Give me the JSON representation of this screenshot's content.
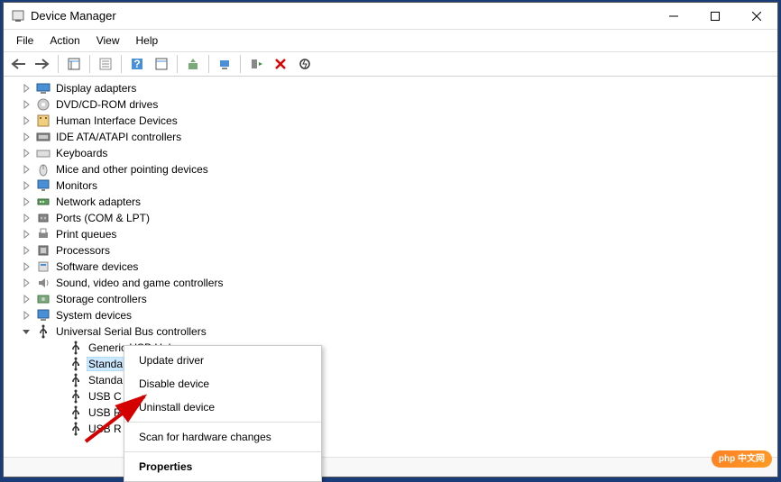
{
  "window": {
    "title": "Device Manager"
  },
  "menu": {
    "file": "File",
    "action": "Action",
    "view": "View",
    "help": "Help"
  },
  "tree": {
    "categories": [
      {
        "name": "Display adapters",
        "icon": "displayadapter",
        "expanded": false,
        "children": []
      },
      {
        "name": "DVD/CD-ROM drives",
        "icon": "dvd",
        "expanded": false,
        "children": []
      },
      {
        "name": "Human Interface Devices",
        "icon": "hid",
        "expanded": false,
        "children": []
      },
      {
        "name": "IDE ATA/ATAPI controllers",
        "icon": "ide",
        "expanded": false,
        "children": []
      },
      {
        "name": "Keyboards",
        "icon": "keyboard",
        "expanded": false,
        "children": []
      },
      {
        "name": "Mice and other pointing devices",
        "icon": "mouse",
        "expanded": false,
        "children": []
      },
      {
        "name": "Monitors",
        "icon": "monitor",
        "expanded": false,
        "children": []
      },
      {
        "name": "Network adapters",
        "icon": "network",
        "expanded": false,
        "children": []
      },
      {
        "name": "Ports (COM & LPT)",
        "icon": "port",
        "expanded": false,
        "children": []
      },
      {
        "name": "Print queues",
        "icon": "printer",
        "expanded": false,
        "children": []
      },
      {
        "name": "Processors",
        "icon": "cpu",
        "expanded": false,
        "children": []
      },
      {
        "name": "Software devices",
        "icon": "software",
        "expanded": false,
        "children": []
      },
      {
        "name": "Sound, video and game controllers",
        "icon": "sound",
        "expanded": false,
        "children": []
      },
      {
        "name": "Storage controllers",
        "icon": "storage",
        "expanded": false,
        "children": []
      },
      {
        "name": "System devices",
        "icon": "system",
        "expanded": false,
        "children": []
      },
      {
        "name": "Universal Serial Bus controllers",
        "icon": "usb",
        "expanded": true,
        "children": [
          {
            "name": "Generic USB Hub",
            "icon": "usb",
            "selected": false
          },
          {
            "name": "Standa",
            "icon": "usb",
            "selected": true,
            "truncated_visible": "Standa"
          },
          {
            "name": "Standa",
            "icon": "usb",
            "selected": false
          },
          {
            "name": "USB C",
            "icon": "usb",
            "selected": false
          },
          {
            "name": "USB R",
            "icon": "usb",
            "selected": false
          },
          {
            "name": "USB R",
            "icon": "usb",
            "selected": false
          }
        ]
      }
    ]
  },
  "context_menu": {
    "update": "Update driver",
    "disable": "Disable device",
    "uninstall": "Uninstall device",
    "scan": "Scan for hardware changes",
    "properties": "Properties"
  },
  "watermark": {
    "text": "php 中文网"
  }
}
